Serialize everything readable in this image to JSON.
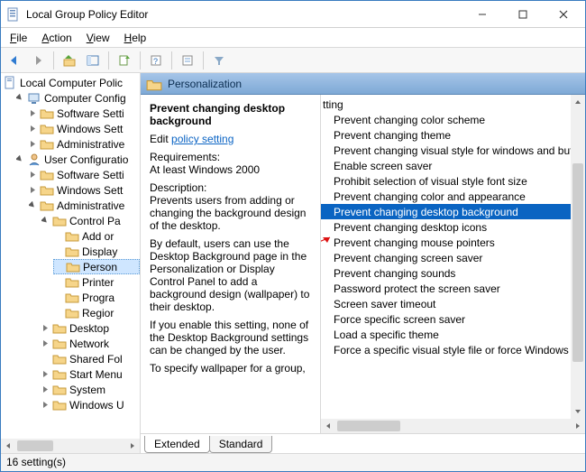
{
  "window": {
    "title": "Local Group Policy Editor"
  },
  "menu": {
    "file": "File",
    "action": "Action",
    "view": "View",
    "help": "Help"
  },
  "tree": {
    "root": "Local Computer Polic",
    "comp": "Computer Config",
    "comp_soft": "Software Setti",
    "comp_win": "Windows Sett",
    "comp_admin": "Administrative",
    "user": "User Configuratio",
    "user_soft": "Software Setti",
    "user_win": "Windows Sett",
    "user_admin": "Administrative",
    "ctrl": "Control Pa",
    "addor": "Add or",
    "display": "Display",
    "person": "Person",
    "printer": "Printer",
    "progra": "Progra",
    "region": "Regior",
    "desktop": "Desktop",
    "network": "Network",
    "shared": "Shared Fol",
    "start": "Start Menu",
    "system": "System",
    "winup": "Windows U"
  },
  "header": {
    "title": "Personalization"
  },
  "detail": {
    "title": "Prevent changing desktop background",
    "edit_label": "Edit",
    "edit_link": "policy setting",
    "req_label": "Requirements:",
    "req_value": "At least Windows 2000",
    "desc_label": "Description:",
    "desc_1": "Prevents users from adding or changing the background design of the desktop.",
    "desc_2": "By default, users can use the Desktop Background page in the Personalization or Display Control Panel to add a background design (wallpaper) to their desktop.",
    "desc_3": "If you enable this setting, none of the Desktop Background settings can be changed by the user.",
    "desc_4": "To specify wallpaper for a group,"
  },
  "settings": [
    "tting",
    "Prevent changing color scheme",
    "Prevent changing theme",
    "Prevent changing visual style for windows and butto",
    "Enable screen saver",
    "Prohibit selection of visual style font size",
    "Prevent changing color and appearance",
    "Prevent changing desktop background",
    "Prevent changing desktop icons",
    "Prevent changing mouse pointers",
    "Prevent changing screen saver",
    "Prevent changing sounds",
    "Password protect the screen saver",
    "Screen saver timeout",
    "Force specific screen saver",
    "Load a specific theme",
    "Force a specific visual style file or force Windows Clas"
  ],
  "selected_index": 7,
  "tabs": {
    "extended": "Extended",
    "standard": "Standard"
  },
  "status": "16 setting(s)"
}
